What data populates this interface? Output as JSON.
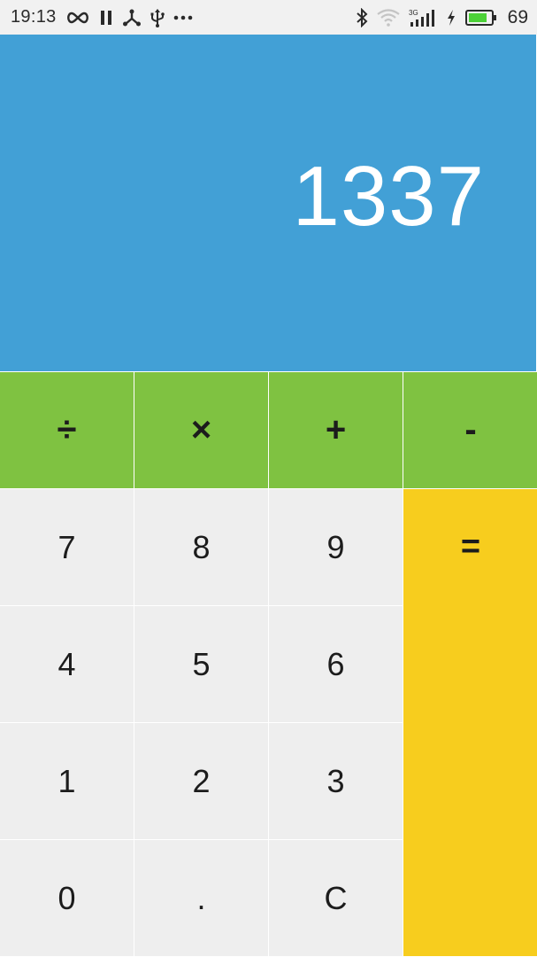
{
  "status_bar": {
    "time": "19:13",
    "battery_level": "69",
    "icons_left": [
      "infinity-icon",
      "pause-icon",
      "share-icon",
      "usb-icon",
      "more-icon"
    ],
    "icons_right": [
      "bluetooth-icon",
      "wifi-icon",
      "signal-3g-icon",
      "charging-icon",
      "battery-icon"
    ],
    "signal_tag": "3G"
  },
  "display": {
    "value": "1337",
    "background": "#42a0d6"
  },
  "operators": {
    "divide": "÷",
    "multiply": "×",
    "add": "+",
    "subtract": "-"
  },
  "keys": {
    "k7": "7",
    "k8": "8",
    "k9": "9",
    "k4": "4",
    "k5": "5",
    "k6": "6",
    "k1": "1",
    "k2": "2",
    "k3": "3",
    "k0": "0",
    "dot": ".",
    "clear": "C",
    "equals": "="
  },
  "colors": {
    "operator_bg": "#7fc241",
    "number_bg": "#eeeeee",
    "equals_bg": "#f7cd1e",
    "battery_fill": "#4cd137"
  }
}
